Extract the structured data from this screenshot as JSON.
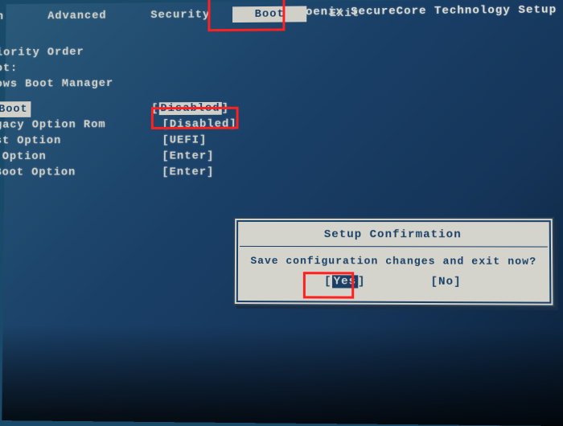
{
  "header": {
    "title": "Phoenix SecureCore Technology Setup",
    "menu": {
      "main": "n",
      "advanced": "Advanced",
      "security": "Security",
      "boot": "Boot",
      "exit": "Exit"
    }
  },
  "content": {
    "line1": "t Priority Order",
    "line2": "[ Boot:",
    "line3": "Windows Boot Manager",
    "rows": {
      "secure_boot": {
        "label": "ure Boot",
        "value": "Disabled"
      },
      "legacy_rom": {
        "label": "d Legacy Option Rom",
        "value": "Disabled"
      },
      "list_option": {
        "label": "t List Option",
        "value": "UEFI"
      },
      "boot_option": {
        "label": " Boot Option",
        "value": "Enter"
      },
      "delete_boot": {
        "label": "ete Boot Option",
        "value": "Enter"
      }
    }
  },
  "dialog": {
    "title": "Setup Confirmation",
    "message": "Save configuration changes and exit now?",
    "yes": "Yes",
    "no": "No"
  }
}
